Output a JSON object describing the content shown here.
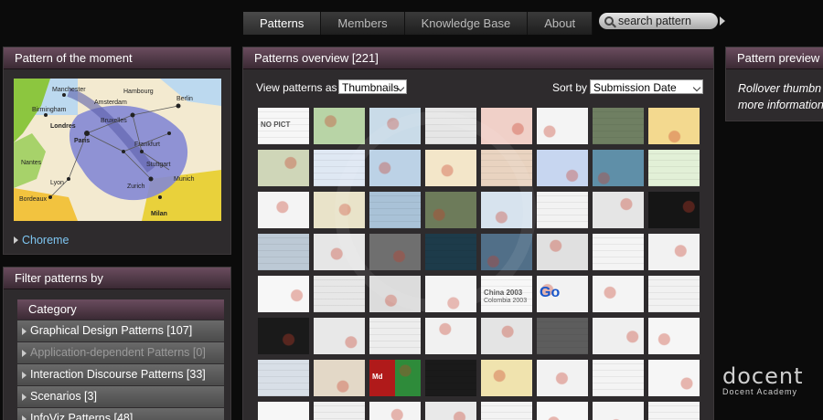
{
  "nav": {
    "tabs": [
      {
        "label": "Patterns",
        "active": true
      },
      {
        "label": "Members"
      },
      {
        "label": "Knowledge Base"
      },
      {
        "label": "About"
      }
    ],
    "search_placeholder": "search pattern"
  },
  "moment": {
    "title": "Pattern of the moment",
    "link": "Choreme",
    "map_labels": [
      "Manchester",
      "Birmingham",
      "Londres",
      "Paris",
      "Berlin",
      "Frankfurt",
      "Stuttgart",
      "Zurich",
      "Lyon",
      "Bordeaux",
      "Milan",
      "Bruxelles",
      "Hambourg",
      "Munich",
      "Nantes",
      "Amsterdam"
    ]
  },
  "filter": {
    "title": "Filter patterns by",
    "category_header": "Category",
    "categories": [
      {
        "label": "Graphical Design Patterns [107]",
        "dim": false
      },
      {
        "label": "Application-dependent Patterns [0]",
        "dim": true
      },
      {
        "label": "Interaction Discourse Patterns [33]",
        "dim": false
      },
      {
        "label": "Scenarios [3]",
        "dim": false
      },
      {
        "label": "InfoViz Patterns [48]",
        "dim": false
      }
    ]
  },
  "overview": {
    "title": "Patterns overview [221]",
    "view_label": "View patterns as",
    "view_value": "Thumbnails",
    "sort_label": "Sort by",
    "sort_value": "Submission Date",
    "thumb_texts": {
      "no_picture": "NO PICT",
      "china": "China 2003",
      "colombia": "Colombia 2003",
      "md": "Md",
      "go": "Go"
    }
  },
  "preview": {
    "title": "Pattern preview",
    "text_line1": "Rollover thumbn",
    "text_line2": "more information"
  },
  "logo": {
    "name": "docent",
    "tagline": "Docent Academy"
  },
  "colors": {
    "panel_header": "#5a3f4f",
    "link": "#7ec6f2",
    "background": "#0b0b0b"
  }
}
